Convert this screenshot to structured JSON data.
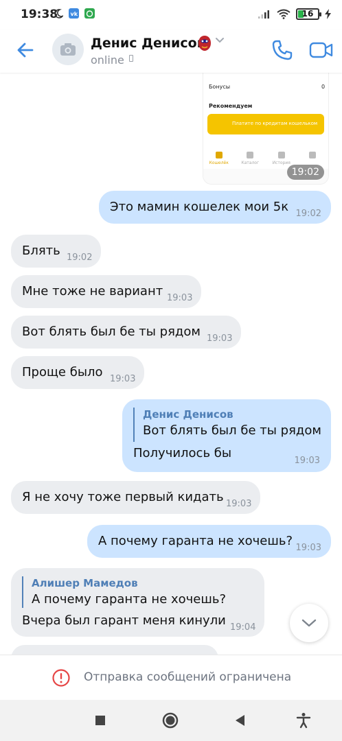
{
  "status_bar": {
    "time": "19:38",
    "battery_level": "16",
    "battery_fraction": 0.16
  },
  "header": {
    "contact_name": "Денис Денисов",
    "status": "online"
  },
  "screenshot_message": {
    "rows": [
      {
        "label": "Бонусы",
        "value": "0"
      },
      {
        "label": "Рекомендуем",
        "value": ""
      }
    ],
    "banner_text": "Платите по кредитам кошельком",
    "nav_items": [
      "Кошелёк",
      "Каталог",
      "История",
      ""
    ],
    "time": "19:02"
  },
  "messages": [
    {
      "id": "m1",
      "direction": "out",
      "text": "Это мамин кошелек мои 5к",
      "time": "19:02"
    },
    {
      "id": "m2",
      "direction": "in",
      "text": "Блять",
      "time": "19:02"
    },
    {
      "id": "m3",
      "direction": "in",
      "text": "Мне тоже не вариант",
      "time": "19:03"
    },
    {
      "id": "m4",
      "direction": "in",
      "text": "Вот блять был бе ты рядом",
      "time": "19:03"
    },
    {
      "id": "m5",
      "direction": "in",
      "text": "Проще было",
      "time": "19:03"
    },
    {
      "id": "m6",
      "direction": "out",
      "text": "Получилось бы",
      "time": "19:03",
      "reply": {
        "author": "Денис Денисов",
        "text": "Вот блять был бе ты рядом"
      }
    },
    {
      "id": "m7",
      "direction": "in",
      "text": "Я не хочу тоже первый кидать",
      "time": "19:03"
    },
    {
      "id": "m8",
      "direction": "out",
      "text": "А почему гаранта не хочешь?",
      "time": "19:03"
    },
    {
      "id": "m9",
      "direction": "in",
      "text": "Вчера был гарант меня кинули",
      "time": "19:04",
      "reply": {
        "author": "Алишер Мамедов",
        "text": "А почему гаранта не хочешь?"
      }
    }
  ],
  "restriction_notice": "Отправка сообщений ограничена",
  "colors": {
    "accent": "#3f8ae0",
    "incoming_bubble": "#ebedf0",
    "outgoing_bubble": "#cce4ff",
    "reply_author": "#4f7fb6",
    "warning": "#e64646"
  },
  "icons": {
    "back": "arrow-left-icon",
    "call": "phone-icon",
    "video": "video-camera-icon",
    "avatar_placeholder": "camera-icon",
    "scroll_down": "chevron-down-icon",
    "restricted": "exclamation-circle-icon",
    "nav": [
      "square-recents-icon",
      "circle-home-icon",
      "triangle-back-icon",
      "accessibility-icon"
    ]
  }
}
